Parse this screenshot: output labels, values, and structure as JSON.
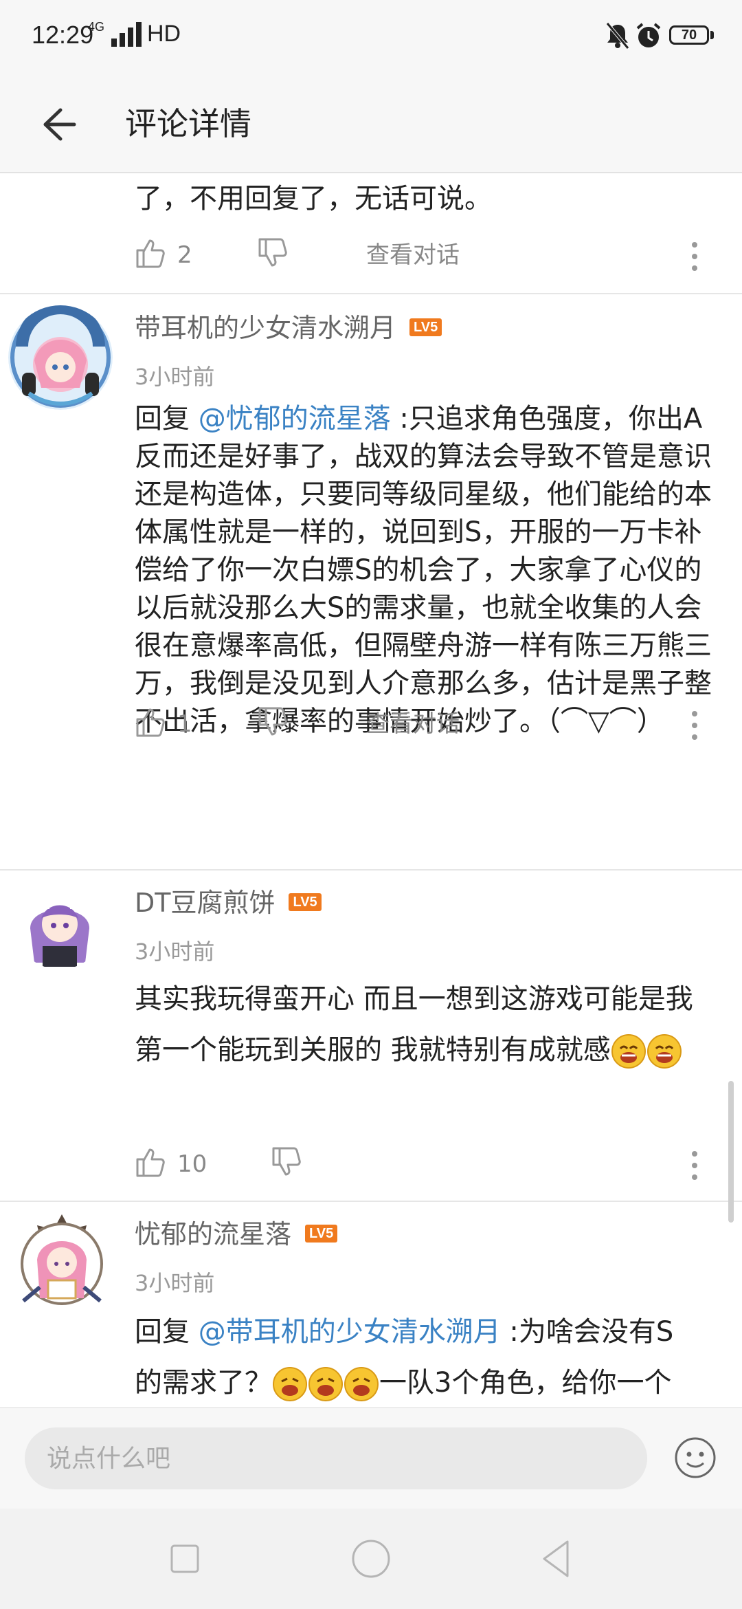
{
  "status_bar": {
    "time": "12:29",
    "network": "4G",
    "hd": "HD",
    "battery": "70"
  },
  "header": {
    "title": "评论详情"
  },
  "comments": [
    {
      "body_tail": "了，不用回复了，无话可说。",
      "likes": "2",
      "view_conversation": "查看对话"
    },
    {
      "username": "带耳机的少女清水溯月",
      "level": "LV5",
      "time": "3小时前",
      "reply_prefix": "回复 ",
      "mention": "@忧郁的流星落",
      "body": " :只追求角色强度，你出A反而还是好事了，战双的算法会导致不管是意识还是构造体，只要同等级同星级，他们能给的本体属性就是一样的，说回到S，开服的一万卡补偿给了你一次白嫖S的机会了，大家拿了心仪的以后就没那么大S的需求量，也就全收集的人会很在意爆率高低，但隔壁舟游一样有陈三万熊三万，我倒是没见到人介意那么多，估计是黑子整不出活，拿爆率的事情开始炒了。（⌒▽⌒）",
      "likes": "1",
      "view_conversation": "查看对话"
    },
    {
      "username": "DT豆腐煎饼",
      "level": "LV5",
      "time": "3小时前",
      "body": "其实我玩得蛮开心 而且一想到这游戏可能是我第一个能玩到关服的 我就特别有成就感",
      "likes": "10"
    },
    {
      "username": "忧郁的流星落",
      "level": "LV5",
      "time": "3小时前",
      "reply_prefix": "回复 ",
      "mention": "@带耳机的少女清水溯月",
      "body_line1": " :为啥会没有S",
      "body_line2_a": "的需求了？",
      "body_line2_b": "一队3个角色，给你一个"
    }
  ],
  "composer": {
    "placeholder": "说点什么吧"
  },
  "colors": {
    "mention": "#3a82c4",
    "level_badge": "#f07a1e",
    "background": "#ffffff",
    "bar": "#f7f7f7"
  }
}
